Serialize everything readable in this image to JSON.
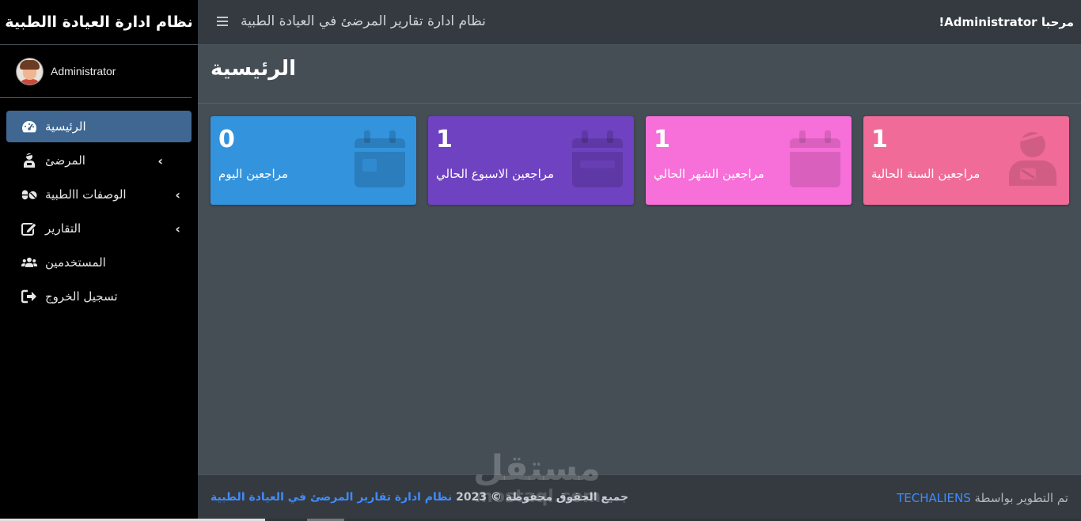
{
  "sidebar": {
    "brand": "نظام ادارة العيادة االطبية",
    "user_name": "Administrator",
    "items": [
      {
        "label": "الرئيسية",
        "icon": "tachometer-icon",
        "active": true,
        "has_children": false
      },
      {
        "label": "المرضئ",
        "icon": "user-injured-icon",
        "active": false,
        "has_children": true
      },
      {
        "label": "الوصفات االطبية",
        "icon": "pills-icon",
        "active": false,
        "has_children": true
      },
      {
        "label": "التقارير",
        "icon": "edit-icon",
        "active": false,
        "has_children": true
      },
      {
        "label": "المستخدمين",
        "icon": "users-icon",
        "active": false,
        "has_children": false
      },
      {
        "label": "تسجيل الخروج",
        "icon": "sign-out-icon",
        "active": false,
        "has_children": false
      }
    ]
  },
  "topbar": {
    "title": "نظام ادارة تقارير المرضئ في العيادة الطبية",
    "welcome": "!Administrator مرحبا"
  },
  "page": {
    "title": "الرئيسية"
  },
  "stats": [
    {
      "value": "0",
      "label": "مراجعين اليوم",
      "color": "#3393dd",
      "icon": "calendar-day-icon"
    },
    {
      "value": "1",
      "label": "مراجعين الاسبوع الحالي",
      "color": "#6f42c1",
      "icon": "calendar-week-icon"
    },
    {
      "value": "1",
      "label": "مراجعين الشهر الحالي",
      "color": "#f76fd8",
      "icon": "calendar-icon"
    },
    {
      "value": "1",
      "label": "مراجعين السنة الحالية",
      "color": "#f06b98",
      "icon": "user-injured-icon"
    }
  ],
  "footer": {
    "copyright_prefix": "جميع الحقوق محفوظة © 2023",
    "copyright_link": "نظام ادارة تقارير المرضئ في العيادة الطبية",
    "dev_prefix": "تم التطوير بواسطة",
    "dev_link": "TECHALIENS"
  },
  "watermark": {
    "text": "مستقل",
    "sub": "mostaql.com"
  },
  "colors": {
    "sidebar_bg": "#000000",
    "active_item": "#3f6791",
    "content_bg": "#454d55",
    "link": "#3f8cff"
  }
}
